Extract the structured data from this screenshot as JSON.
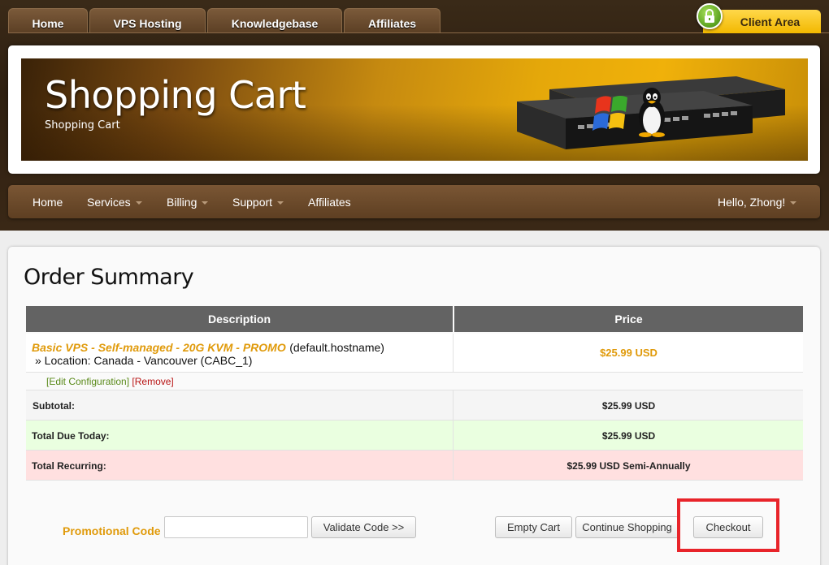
{
  "top_nav": {
    "tabs": [
      "Home",
      "VPS Hosting",
      "Knowledgebase",
      "Affiliates"
    ],
    "client_area": "Client Area"
  },
  "banner": {
    "title": "Shopping Cart",
    "subtitle": "Shopping Cart"
  },
  "main_nav": {
    "items": [
      {
        "label": "Home",
        "dropdown": false
      },
      {
        "label": "Services",
        "dropdown": true
      },
      {
        "label": "Billing",
        "dropdown": true
      },
      {
        "label": "Support",
        "dropdown": true
      },
      {
        "label": "Affiliates",
        "dropdown": false
      }
    ],
    "user_greeting": "Hello, Zhong!"
  },
  "order": {
    "heading": "Order Summary",
    "table_headers": {
      "description": "Description",
      "price": "Price"
    },
    "item": {
      "name": "Basic VPS - Self-managed - 20G KVM - PROMO",
      "hostname": "(default.hostname)",
      "location": "» Location: Canada - Vancouver (CABC_1)",
      "price": "$25.99 USD",
      "edit_link": "[Edit Configuration]",
      "remove_link": "[Remove]"
    },
    "subtotal": {
      "label": "Subtotal:",
      "value": "$25.99 USD"
    },
    "total_due": {
      "label": "Total Due Today:",
      "value": "$25.99 USD"
    },
    "total_recurring": {
      "label": "Total Recurring:",
      "value": "$25.99 USD Semi-Annually"
    }
  },
  "promo": {
    "label": "Promotional Code",
    "input_value": "",
    "validate_button": "Validate Code >>"
  },
  "actions": {
    "empty_cart": "Empty Cart",
    "continue_shopping": "Continue Shopping",
    "checkout": "Checkout"
  },
  "colors": {
    "accent_orange": "#e09a0a",
    "header_brown": "#5e3f22",
    "total_due_bg": "#eaffe0",
    "total_recurring_bg": "#ffe0e0",
    "highlight_red": "#e8242a"
  }
}
